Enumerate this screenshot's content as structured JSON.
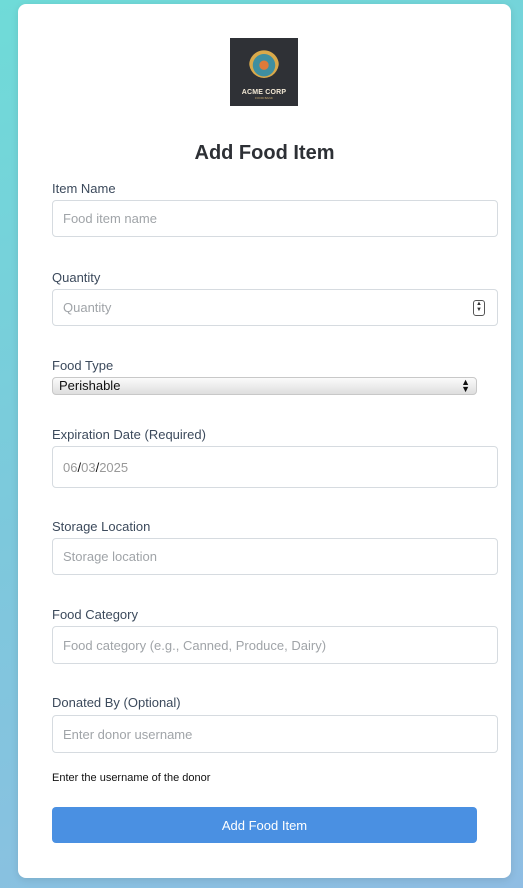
{
  "logo": {
    "title": "ACME CORP",
    "subtitle": "FOOD BANK"
  },
  "heading": "Add Food Item",
  "fields": {
    "item_name": {
      "label": "Item Name",
      "placeholder": "Food item name"
    },
    "quantity": {
      "label": "Quantity",
      "placeholder": "Quantity"
    },
    "food_type": {
      "label": "Food Type",
      "value": "Perishable"
    },
    "expiration": {
      "label": "Expiration Date (Required)",
      "month": "06",
      "day": "03",
      "year": "2025",
      "sep": "/"
    },
    "storage": {
      "label": "Storage Location",
      "placeholder": "Storage location"
    },
    "category": {
      "label": "Food Category",
      "placeholder": "Food category (e.g., Canned, Produce, Dairy)"
    },
    "donor": {
      "label": "Donated By (Optional)",
      "placeholder": "Enter donor username",
      "help": "Enter the username of the donor"
    }
  },
  "submit_label": "Add Food Item",
  "colors": {
    "accent": "#4a90e2"
  }
}
